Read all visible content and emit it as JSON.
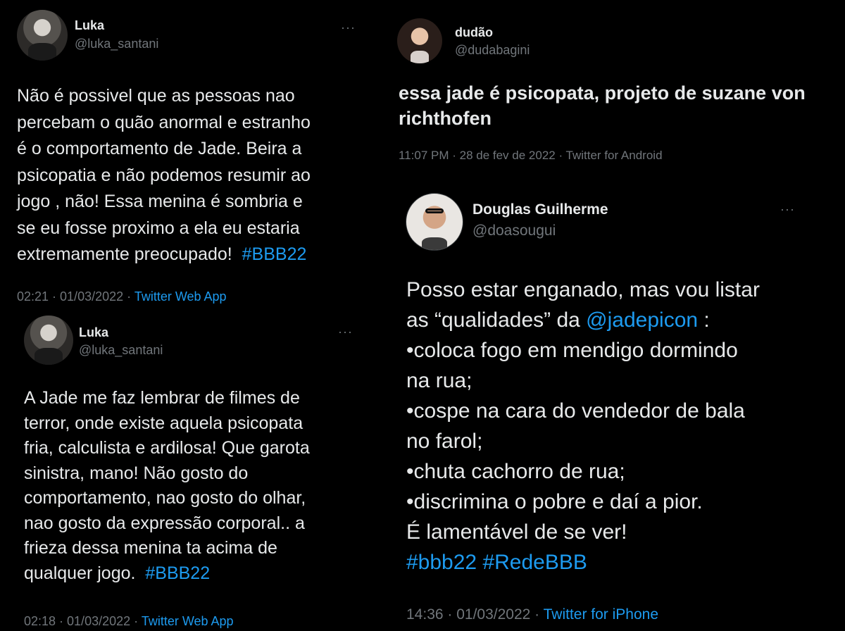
{
  "tweets": [
    {
      "name": "Luka",
      "handle": "@luka_santani",
      "more": "···",
      "avatar_icon": "profile-photo",
      "lines": [
        "Não é possivel que as pessoas nao",
        "percebam o quão anormal e estranho",
        "é o comportamento de Jade. Beira a",
        "psicopatia e não podemos resumir ao",
        "jogo , não! Essa menina é sombria e",
        "se eu fosse proximo a ela eu estaria",
        "extremamente preocupado!"
      ],
      "hashtag": "#BBB22",
      "timestamp": "02:21 · 01/03/2022 · ",
      "source": "Twitter Web App"
    },
    {
      "name": "Luka",
      "handle": "@luka_santani",
      "more": "···",
      "avatar_icon": "profile-photo",
      "lines": [
        "A Jade me faz lembrar de filmes de",
        "terror, onde existe aquela psicopata",
        "fria, calculista e ardilosa! Que garota",
        "sinistra, mano! Não gosto do",
        "comportamento, nao gosto do olhar,",
        "nao gosto da expressão corporal.. a",
        "frieza dessa menina ta acima de",
        "qualquer jogo."
      ],
      "hashtag": "#BBB22",
      "timestamp": "02:18 · 01/03/2022 · ",
      "source": "Twitter Web App"
    },
    {
      "name": "dudão",
      "handle": "@dudabagini",
      "avatar_icon": "profile-photo",
      "lines": [
        "essa jade é psicopata, projeto de suzane von",
        "richthofen"
      ],
      "timestamp": "11:07 PM · 28 de fev de 2022 · Twitter for Android"
    },
    {
      "name": "Douglas Guilherme",
      "handle": "@doasougui",
      "more": "···",
      "avatar_icon": "profile-photo",
      "line1": "Posso estar enganado, mas vou listar",
      "line2_pre": "as “qualidades” da ",
      "mention": "@jadepicon",
      "line2_post": " :",
      "lines": [
        "•coloca fogo em mendigo dormindo",
        "na rua;",
        "•cospe na cara do vendedor de bala",
        "no farol;",
        "•chuta cachorro de rua;",
        "•discrimina o pobre e daí a pior.",
        "É lamentável de se ver!"
      ],
      "hashtags": "#bbb22 #RedeBBB",
      "timestamp": "14:36 · 01/03/2022 · ",
      "source": "Twitter for iPhone"
    }
  ]
}
